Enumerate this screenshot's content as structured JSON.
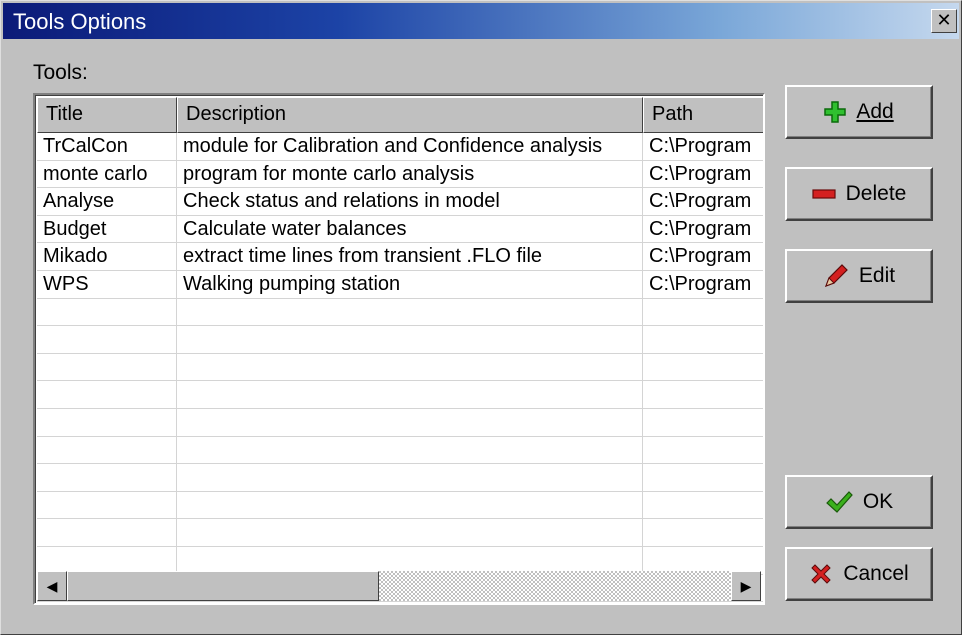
{
  "window": {
    "title": "Tools Options",
    "close_label": "✕"
  },
  "tools_label": "Tools:",
  "list": {
    "columns": [
      "Title",
      "Description",
      "Path"
    ],
    "rows": [
      {
        "title": "TrCalCon",
        "description": "module for Calibration and Confidence analysis",
        "path": "C:\\Program"
      },
      {
        "title": "monte carlo",
        "description": "program for monte carlo analysis",
        "path": "C:\\Program"
      },
      {
        "title": "Analyse",
        "description": "Check status and relations in model",
        "path": "C:\\Program"
      },
      {
        "title": "Budget",
        "description": "Calculate water balances",
        "path": "C:\\Program"
      },
      {
        "title": "Mikado",
        "description": "extract time lines from transient .FLO file",
        "path": "C:\\Program"
      },
      {
        "title": "WPS",
        "description": "Walking pumping station",
        "path": "C:\\Program"
      }
    ],
    "empty_row_count": 11
  },
  "buttons": {
    "add": {
      "label": "Add",
      "icon": "plus-icon",
      "color": "#1fa31f"
    },
    "delete": {
      "label": "Delete",
      "icon": "minus-icon",
      "color": "#c01818"
    },
    "edit": {
      "label": "Edit",
      "icon": "pencil-icon",
      "color": "#c01818"
    },
    "ok": {
      "label": "OK",
      "icon": "checkmark-icon",
      "color": "#2e9a1a"
    },
    "cancel": {
      "label": "Cancel",
      "icon": "cross-icon",
      "color": "#c01818"
    }
  }
}
